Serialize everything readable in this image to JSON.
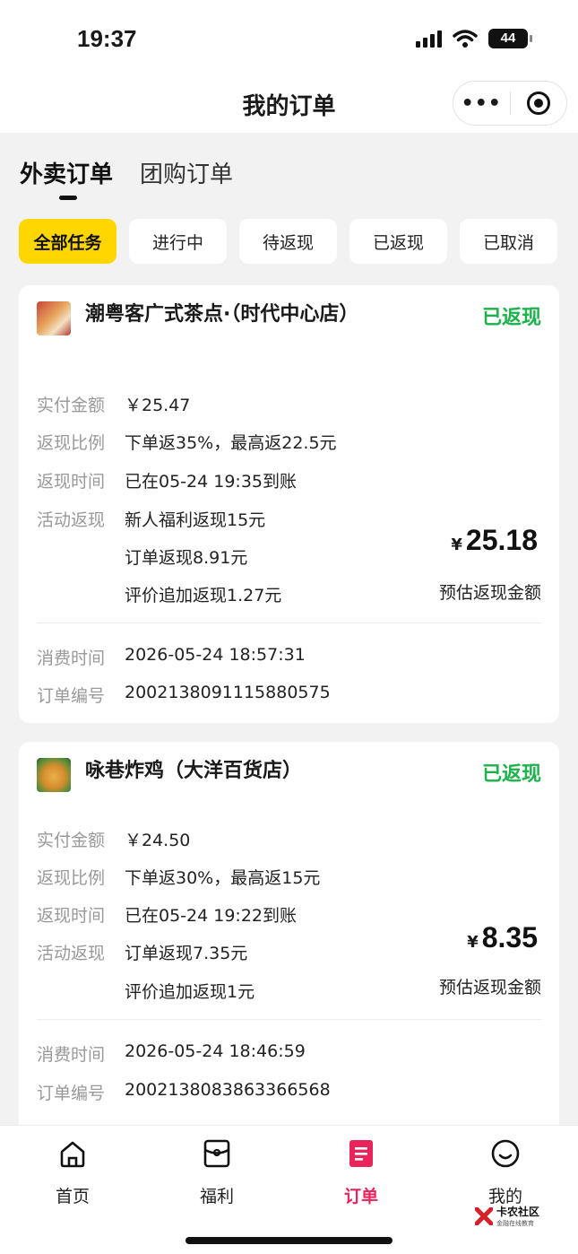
{
  "status_bar": {
    "time": "19:37",
    "battery": "44"
  },
  "nav": {
    "title": "我的订单",
    "more_label": "•••"
  },
  "tabs": [
    {
      "label": "外卖订单",
      "active": true
    },
    {
      "label": "团购订单",
      "active": false
    }
  ],
  "filters": [
    {
      "label": "全部任务",
      "active": true
    },
    {
      "label": "进行中",
      "active": false
    },
    {
      "label": "待返现",
      "active": false
    },
    {
      "label": "已返现",
      "active": false
    },
    {
      "label": "已取消",
      "active": false
    }
  ],
  "labels": {
    "paid": "实付金额",
    "ratio": "返现比例",
    "time": "返现时间",
    "activity": "活动返现",
    "consume_time": "消费时间",
    "order_no": "订单编号",
    "estimate": "预估返现金额",
    "currency": "¥"
  },
  "orders": [
    {
      "shop": "潮粤客广式茶点·（时代中心店）",
      "status": "已返现",
      "paid": "￥25.47",
      "ratio": "下单返35%，最高返22.5元",
      "time": "已在05-24 19:35到账",
      "activity": [
        "新人福利返现15元",
        "订单返现8.91元",
        "评价追加返现1.27元"
      ],
      "amount": "25.18",
      "consume_time": "2026-05-24 18:57:31",
      "order_no": "2002138091115880575"
    },
    {
      "shop": "咏巷炸鸡（大洋百货店）",
      "status": "已返现",
      "paid": "￥24.50",
      "ratio": "下单返30%，最高返15元",
      "time": "已在05-24 19:22到账",
      "activity": [
        "订单返现7.35元",
        "评价追加返现1元"
      ],
      "amount": "8.35",
      "consume_time": "2026-05-24 18:46:59",
      "order_no": "2002138083863366568"
    }
  ],
  "tabbar": [
    {
      "label": "首页",
      "icon": "home-icon",
      "active": false
    },
    {
      "label": "福利",
      "icon": "gift-icon",
      "active": false
    },
    {
      "label": "订单",
      "icon": "order-icon",
      "active": true
    },
    {
      "label": "我的",
      "icon": "smile-icon",
      "active": false
    }
  ],
  "watermark": {
    "title": "卡农社区",
    "subtitle": "金融在线教育"
  },
  "colors": {
    "accent_yellow": "#ffd600",
    "cashback_green": "#1db24b",
    "active_tab_pink": "#e8245a"
  }
}
